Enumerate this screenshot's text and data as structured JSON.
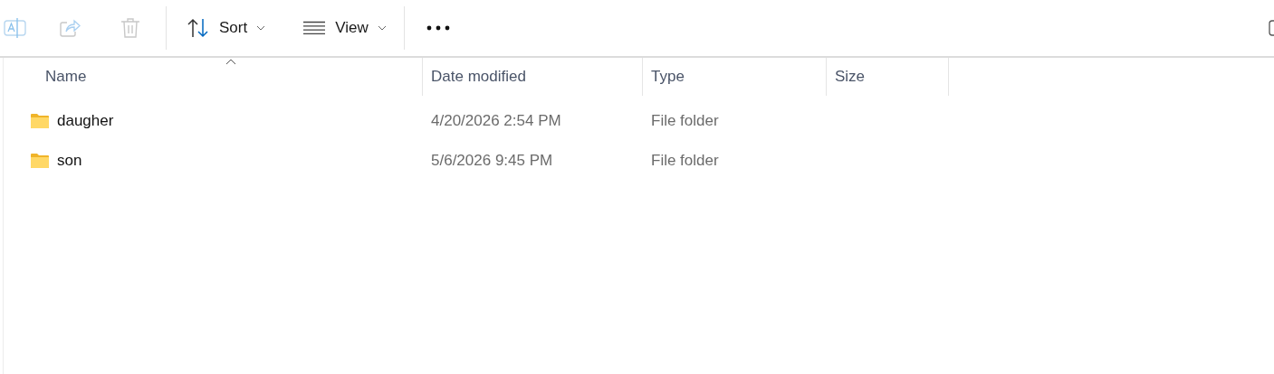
{
  "toolbar": {
    "buttons": [
      {
        "kind": "rename",
        "disabled": true
      },
      {
        "kind": "share",
        "disabled": true
      },
      {
        "kind": "delete",
        "disabled": true
      },
      {
        "kind": "sort",
        "label": "Sort",
        "disabled": false
      },
      {
        "kind": "view",
        "label": "View",
        "disabled": false
      },
      {
        "kind": "more",
        "disabled": false
      }
    ]
  },
  "table": {
    "columns": [
      {
        "label": "Name",
        "sorted": true
      },
      {
        "label": "Date modified",
        "sorted": false
      },
      {
        "label": "Type",
        "sorted": false
      },
      {
        "label": "Size",
        "sorted": false
      }
    ],
    "rows": [
      {
        "name": "daugher",
        "date_modified": "4/20/2026 2:54 PM",
        "type": "File folder",
        "selected": false
      },
      {
        "name": "son",
        "date_modified": "5/6/2026 9:45 PM",
        "type": "File folder",
        "selected": false
      }
    ]
  }
}
